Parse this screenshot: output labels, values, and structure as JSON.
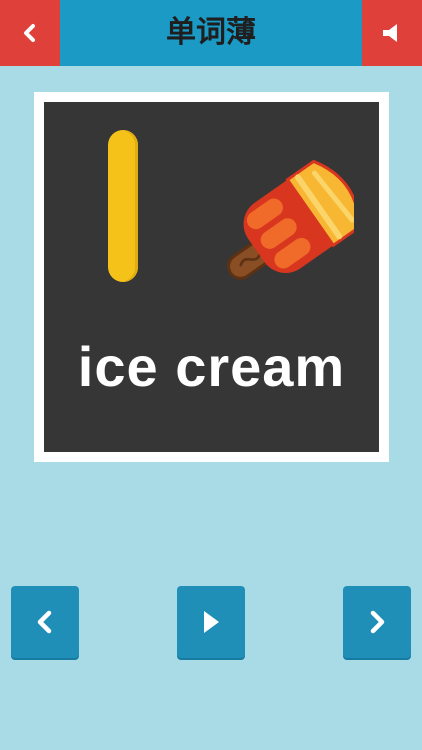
{
  "header": {
    "title": "单词薄",
    "back_icon": "chevron-left-icon",
    "sound_icon": "speaker-icon"
  },
  "card": {
    "letter": "I",
    "word": "ice cream",
    "image": "popsicle-illustration"
  },
  "controls": {
    "prev_icon": "chevron-left-icon",
    "play_icon": "play-icon",
    "next_icon": "chevron-right-icon"
  },
  "colors": {
    "header_bg": "#1a9ac4",
    "accent_red": "#e0403a",
    "background": "#a8dbe6",
    "card_bg": "#363636",
    "button_bg": "#1f8fb8"
  }
}
